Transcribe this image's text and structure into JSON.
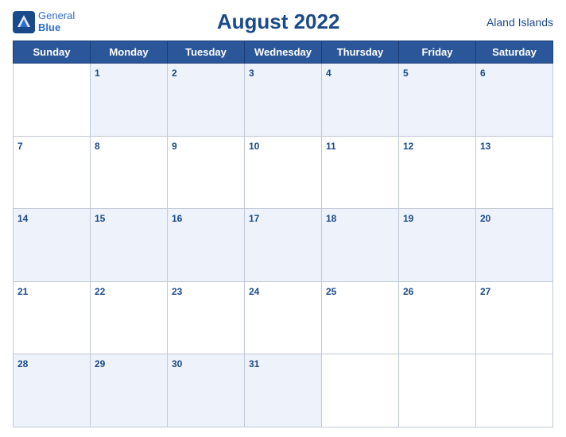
{
  "header": {
    "logo_line1": "General",
    "logo_line2": "Blue",
    "title": "August 2022",
    "region": "Aland Islands"
  },
  "weekdays": [
    "Sunday",
    "Monday",
    "Tuesday",
    "Wednesday",
    "Thursday",
    "Friday",
    "Saturday"
  ],
  "weeks": [
    [
      null,
      1,
      2,
      3,
      4,
      5,
      6
    ],
    [
      7,
      8,
      9,
      10,
      11,
      12,
      13
    ],
    [
      14,
      15,
      16,
      17,
      18,
      19,
      20
    ],
    [
      21,
      22,
      23,
      24,
      25,
      26,
      27
    ],
    [
      28,
      29,
      30,
      31,
      null,
      null,
      null
    ]
  ]
}
